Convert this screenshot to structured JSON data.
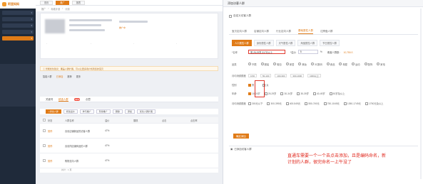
{
  "sidebar": {
    "logo_text": "阿里妈妈",
    "items": [
      "",
      "",
      "",
      "",
      ""
    ]
  },
  "topbar": {
    "tabs": [
      "首页",
      "推广",
      "报表"
    ]
  },
  "breadcrumb": {
    "items": [
      "推广",
      "标准计划",
      "计划"
    ]
  },
  "info_card": {
    "status_label": "推广中",
    "stats": [
      "-",
      "-",
      "-",
      "-"
    ]
  },
  "tip": {
    "text": "智能优化建议：覆盖人群扩展，可以让更多用户找到您的宝贝"
  },
  "summary_row": {
    "items": [
      "智能人群",
      "已添加",
      "推荐",
      "更多"
    ]
  },
  "sub_tabs": {
    "items": [
      "关键词",
      "精选人群",
      "创意"
    ],
    "badge": "NEW"
  },
  "toolbar": {
    "buttons": [
      "+添加人群",
      "修改溢价",
      "参与推广",
      "暂停推广",
      "删除",
      "添加",
      "优化人群扩展"
    ]
  },
  "table": {
    "headers": [
      "",
      "状态",
      "人群名称",
      "溢价",
      "展现",
      "点击",
      "点击率"
    ],
    "rows": [
      {
        "status": "暂停",
        "name": "喜欢店铺新品的访客人群",
        "premium": "47%"
      },
      {
        "status": "暂停",
        "name": "喜欢同店铺商品的人群",
        "premium": "47%"
      },
      {
        "status": "暂停",
        "name": "购物意向人群",
        "premium": "47%"
      }
    ],
    "footer_text": "共计：1 页"
  },
  "modal": {
    "title": "添加访客人群",
    "custom_label": "自定义访客人群",
    "main_tabs": [
      "宝贝定向人群",
      "店铺定向人群",
      "行业定向人群",
      "基础属性人群",
      "达摩盘人群"
    ],
    "active_main_tab": "基础属性人群",
    "sub_tabs": [
      "人口属性人群",
      "身份属性人群",
      "天气属性人群",
      "淘宝属性人群",
      "节日属性人群"
    ],
    "active_sub_tab": "人口属性人群",
    "name_label": "*名称",
    "name_value": "男,25-29岁,317元以上",
    "premium_label": "*溢价",
    "premium_value": "5",
    "premium_unit": "%",
    "coverage_label": "覆盖人群数：",
    "coverage_value": "10,750人",
    "rows": [
      {
        "label": "品类",
        "options": [
          "不限",
          "服装",
          "鞋包",
          "家居",
          "美妆",
          "3C数码",
          "食品",
          "母婴",
          "运动",
          "配饰",
          "家电"
        ]
      },
      {
        "label": "月均消费额度",
        "options": [
          "0-50",
          "50-100",
          "100-300",
          "300-1000",
          "1000以上"
        ]
      },
      {
        "label": "性别",
        "options": [
          "男",
          "女"
        ]
      },
      {
        "label": "年龄",
        "options": [
          "18-24岁",
          "25-29岁",
          "30-34岁",
          "35-39岁",
          "40-49岁",
          "50岁及以上"
        ]
      },
      {
        "label": "月均消费额度",
        "options": [
          "300元以下",
          "300-399元",
          "400-549元",
          "550-749元",
          "750-1049元",
          "1050-1749元",
          "1750元及以上"
        ]
      }
    ],
    "confirm_button": "确定添加",
    "footer_label": "已添加访客人群"
  },
  "annotation": {
    "text": "直通车需要一个一个去点击添加，且是编码命名，新计划的人群，很完命名一上午没了"
  },
  "colors": {
    "accent": "#e07b17",
    "alert": "#e0261b",
    "sidebar": "#1f2a3a"
  },
  "icons": [
    "logo-icon",
    "checkbox-icon",
    "radio-icon",
    "info-icon"
  ]
}
